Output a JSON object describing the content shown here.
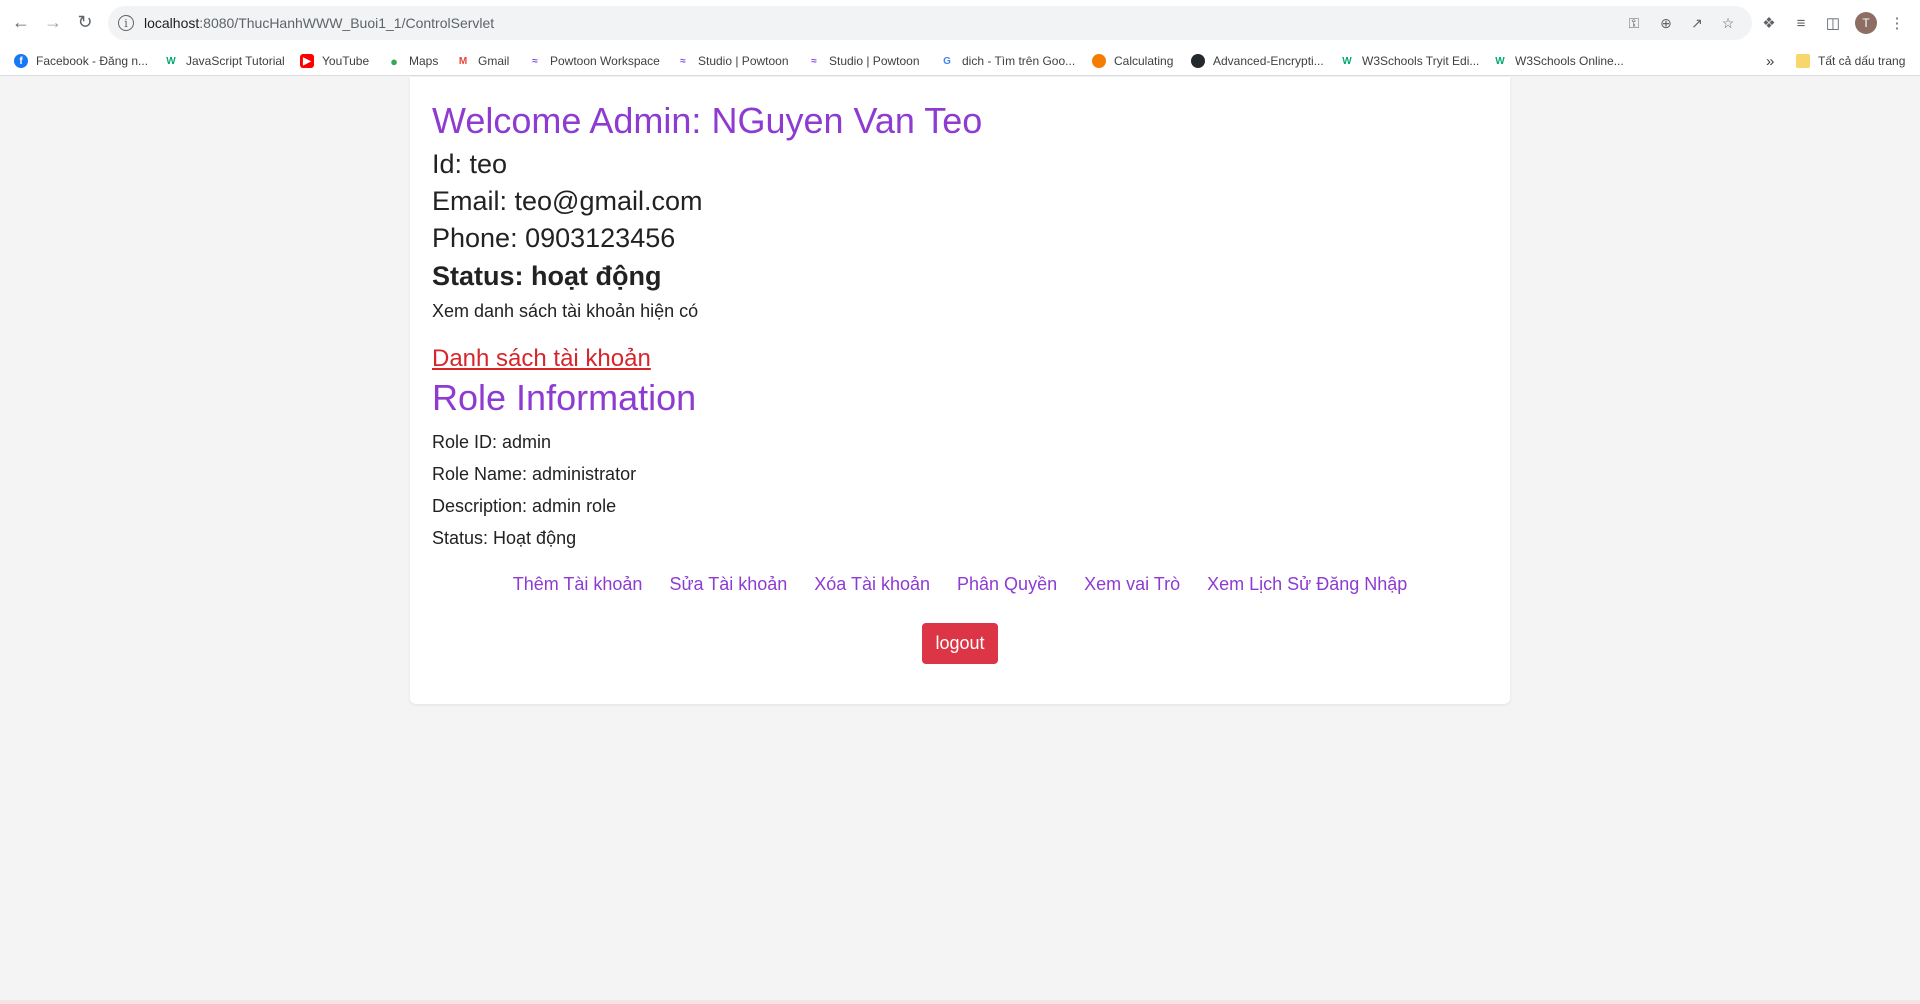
{
  "browser": {
    "url_host": "localhost",
    "url_rest": ":8080/ThucHanhWWW_Buoi1_1/ControlServlet",
    "avatar_letter": "T",
    "bookmarks": [
      {
        "label": "Facebook - Đăng n...",
        "icon": "facebook-icon",
        "color": "#1877f2"
      },
      {
        "label": "JavaScript Tutorial",
        "icon": "w3schools-icon",
        "color": "#04aa6d"
      },
      {
        "label": "YouTube",
        "icon": "youtube-icon",
        "color": "#ff0000"
      },
      {
        "label": "Maps",
        "icon": "maps-icon",
        "color": "#34a853"
      },
      {
        "label": "Gmail",
        "icon": "gmail-icon",
        "color": "#ea4335"
      },
      {
        "label": "Powtoon Workspace",
        "icon": "powtoon-icon",
        "color": "#7b4ae2"
      },
      {
        "label": "Studio | Powtoon",
        "icon": "powtoon-icon",
        "color": "#7b4ae2"
      },
      {
        "label": "Studio | Powtoon",
        "icon": "powtoon-icon",
        "color": "#7b4ae2"
      },
      {
        "label": "dich - Tìm trên Goo...",
        "icon": "google-icon",
        "color": "#4285f4"
      },
      {
        "label": "Calculating",
        "icon": "pumpkin-icon",
        "color": "#f57c00"
      },
      {
        "label": "Advanced-Encrypti...",
        "icon": "github-icon",
        "color": "#24292e"
      },
      {
        "label": "W3Schools Tryit Edi...",
        "icon": "w3schools-icon",
        "color": "#04aa6d"
      },
      {
        "label": "W3Schools Online...",
        "icon": "w3schools-icon",
        "color": "#04aa6d"
      }
    ],
    "more_bookmarks": "»",
    "all_bookmarks_label": "Tất cả dấu trang"
  },
  "page": {
    "welcome": "Welcome Admin: NGuyen Van Teo",
    "id_line": "Id: teo",
    "email_line": "Email: teo@gmail.com",
    "phone_line": "Phone: 0903123456",
    "status_line": "Status: hoạt động",
    "view_list_text": "Xem danh sách tài khoản hiện có",
    "account_list_link": "Danh sách tài khoản",
    "role_title": "Role Information",
    "role_id": "Role ID: admin",
    "role_name": "Role Name: administrator",
    "role_description": "Description: admin role",
    "role_status": "Status: Hoạt động",
    "actions": [
      "Thêm Tài khoản",
      "Sửa Tài khoản",
      "Xóa Tài khoản",
      "Phân Quyền",
      "Xem vai Trò",
      "Xem Lịch Sử Đăng Nhập"
    ],
    "logout_label": "logout"
  },
  "colors": {
    "accent_purple": "#8e3bd1",
    "link_red": "#d7262b",
    "logout_red": "#dc3545"
  }
}
